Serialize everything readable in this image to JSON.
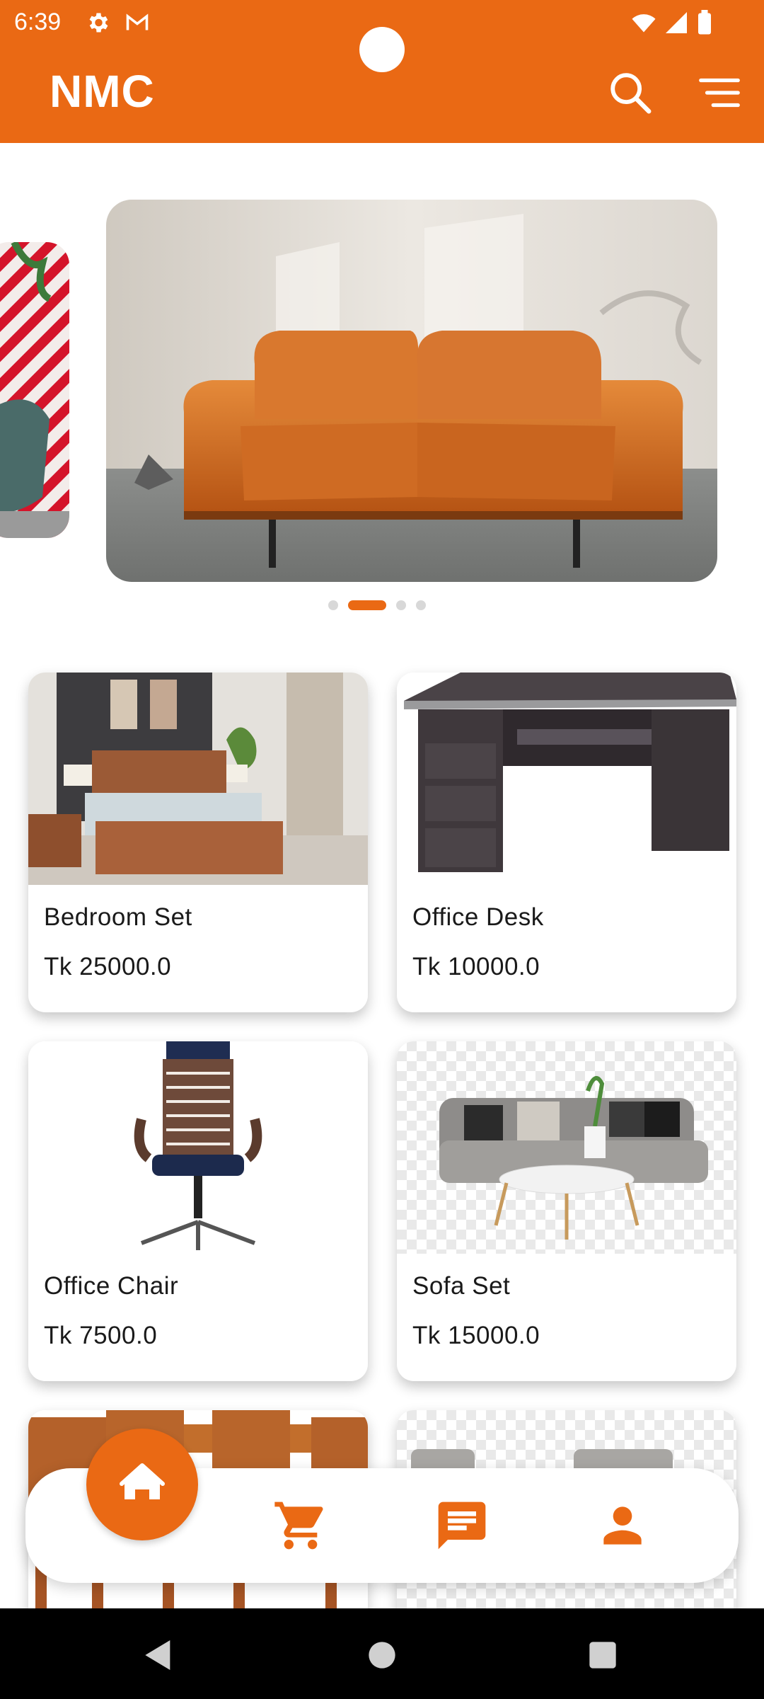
{
  "status_bar": {
    "time": "6:39",
    "icons": [
      "settings-icon",
      "gmail-icon",
      "wifi-icon",
      "signal-icon",
      "battery-icon"
    ]
  },
  "app_bar": {
    "title": "NMC",
    "actions": [
      "search-icon",
      "filter-menu-icon"
    ]
  },
  "carousel": {
    "slides": [
      "red-striped-chair-photo",
      "orange-leather-sofa-photo",
      "slide-3",
      "slide-4"
    ],
    "active_index": 1
  },
  "products": [
    {
      "name": "Bedroom Set",
      "price": "Tk 25000.0"
    },
    {
      "name": "Office Desk",
      "price": "Tk 10000.0"
    },
    {
      "name": "Office Chair",
      "price": "Tk 7500.0"
    },
    {
      "name": "Sofa Set",
      "price": "Tk 15000.0"
    },
    {
      "name": "",
      "price": ""
    },
    {
      "name": "",
      "price": ""
    }
  ],
  "bottom_nav": {
    "items": [
      "home-icon",
      "cart-icon",
      "chat-icon",
      "profile-icon"
    ],
    "active": "home-icon"
  },
  "colors": {
    "accent": "#ea6914",
    "background": "#ffffff",
    "system_nav": "#000000"
  }
}
